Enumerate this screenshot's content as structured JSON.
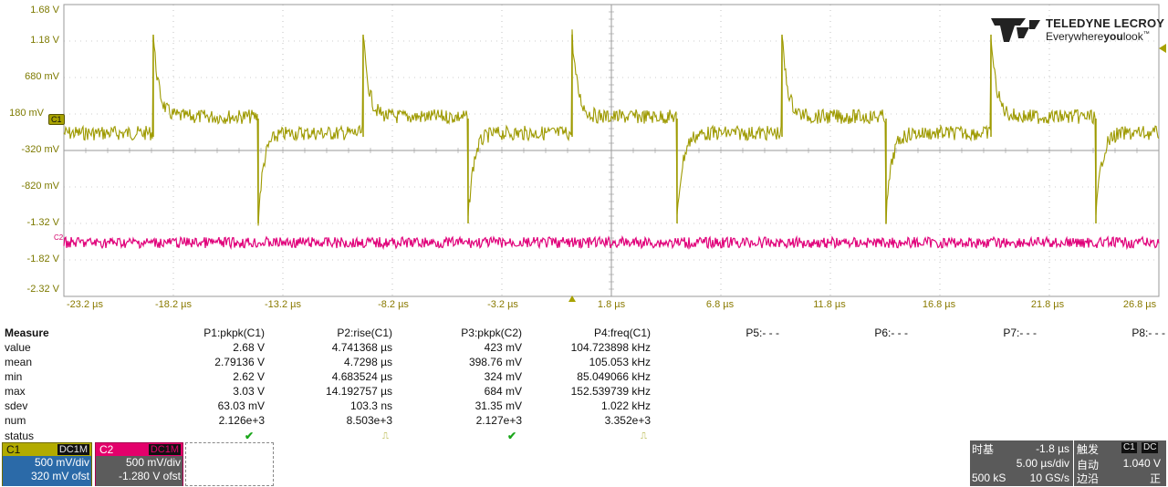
{
  "scope": {
    "y_labels": [
      "1.68 V",
      "1.18 V",
      "680 mV",
      "180 mV",
      "-320 mV",
      "-820 mV",
      "-1.32 V",
      "-1.82 V",
      "-2.32 V"
    ],
    "x_labels": [
      "-23.2 µs",
      "-18.2 µs",
      "-13.2 µs",
      "-8.2 µs",
      "-3.2 µs",
      "1.8 µs",
      "6.8 µs",
      "11.8 µs",
      "16.8 µs",
      "21.8 µs",
      "26.8 µs"
    ],
    "ch1_marker": "C1",
    "ch2_marker": "C2",
    "logo_name": "TELEDYNE LECROY",
    "logo_tag_a": "Everywhere",
    "logo_tag_b": "you",
    "logo_tag_c": "look",
    "logo_tm": "™",
    "colors": {
      "ch1": "#9e9a00",
      "ch2": "#e0007a",
      "grid": "#9a9a9a"
    }
  },
  "measure": {
    "header": "Measure",
    "params": [
      "P1:pkpk(C1)",
      "P2:rise(C1)",
      "P3:pkpk(C2)",
      "P4:freq(C1)",
      "P5:- - -",
      "P6:- - -",
      "P7:- - -",
      "P8:- - -"
    ],
    "rows": [
      {
        "label": "value",
        "vals": [
          "2.68 V",
          "4.741368 µs",
          "423 mV",
          "104.723898 kHz"
        ]
      },
      {
        "label": "mean",
        "vals": [
          "2.79136 V",
          "4.7298 µs",
          "398.76 mV",
          "105.053 kHz"
        ]
      },
      {
        "label": "min",
        "vals": [
          "2.62 V",
          "4.683524 µs",
          "324 mV",
          "85.049066 kHz"
        ]
      },
      {
        "label": "max",
        "vals": [
          "3.03 V",
          "14.192757 µs",
          "684 mV",
          "152.539739 kHz"
        ]
      },
      {
        "label": "sdev",
        "vals": [
          "63.03 mV",
          "103.3 ns",
          "31.35 mV",
          "1.022 kHz"
        ]
      },
      {
        "label": "num",
        "vals": [
          "2.126e+3",
          "8.503e+3",
          "2.127e+3",
          "3.352e+3"
        ]
      }
    ],
    "status_label": "status",
    "status": [
      "ok-check-icon",
      "histogram-icon",
      "ok-check-icon",
      "histogram-icon"
    ]
  },
  "channels": [
    {
      "name": "C1",
      "coupling": "DC1M",
      "vdiv": "500 mV/div",
      "offset": "320 mV ofst"
    },
    {
      "name": "C2",
      "coupling": "DC1M",
      "vdiv": "500 mV/div",
      "offset": "-1.280 V ofst"
    }
  ],
  "timebase": {
    "title": "时基",
    "delay": "-1.8 µs",
    "tdiv": "5.00 µs/div",
    "samples": "500 kS",
    "rate": "10 GS/s"
  },
  "trigger": {
    "title": "触发",
    "source": "C1",
    "coupling": "DC",
    "mode": "自动",
    "level": "1.040 V",
    "type": "边沿",
    "slope": "正"
  }
}
